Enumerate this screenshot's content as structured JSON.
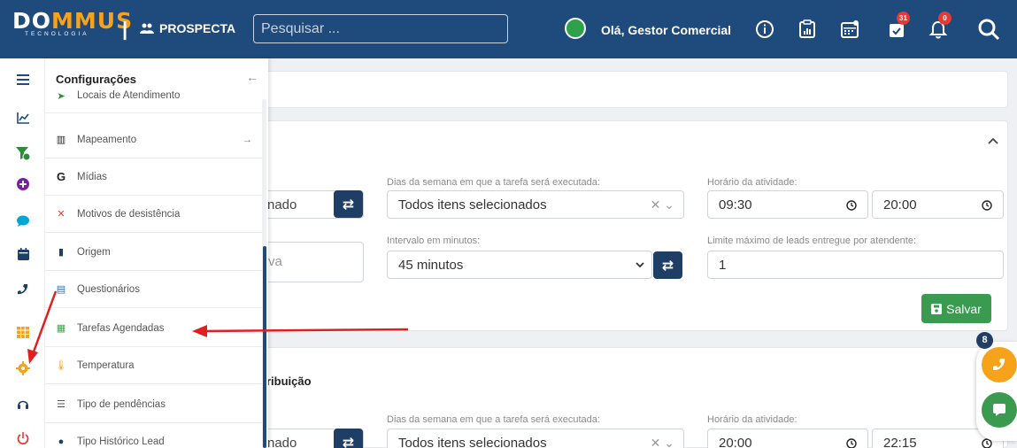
{
  "header": {
    "logo_brand_pre": "DO",
    "logo_brand_u": "MMUS",
    "logo_sub": "TECNOLOGIA",
    "separator": "|",
    "module": "PROSPECTA",
    "search_placeholder": "Pesquisar ...",
    "greeting": "Olá, Gestor Comercial",
    "calendar_badge": "31",
    "notifications_badge": "0"
  },
  "panel": {
    "title": "Configurações",
    "items": [
      {
        "label": "Locais de Atendimento",
        "icon": "location-arrow-icon"
      },
      {
        "label": "Mapeamento",
        "icon": "map-icon"
      },
      {
        "label": "Mídias",
        "icon": "google-icon"
      },
      {
        "label": "Motivos de desistência",
        "icon": "close-icon"
      },
      {
        "label": "Origem",
        "icon": "bookmark-icon"
      },
      {
        "label": "Questionários",
        "icon": "file-icon"
      },
      {
        "label": "Tarefas Agendadas",
        "icon": "calendar-icon"
      },
      {
        "label": "Temperatura",
        "icon": "thermometer-icon"
      },
      {
        "label": "Tipo de pendências",
        "icon": "list-icon"
      },
      {
        "label": "Tipo Histórico Lead",
        "icon": "circle-icon"
      }
    ]
  },
  "main": {
    "section2_title_partial": "ribuição",
    "row1": {
      "left_partial": "nado",
      "days_label": "Dias da semana em que a tarefa será executada:",
      "days_value": "Todos itens selecionados",
      "time_label": "Horário da atividade:",
      "time_start": "09:30",
      "time_end": "20:00"
    },
    "row2": {
      "left_partial": "va",
      "interval_label": "Intervalo em minutos:",
      "interval_value": "45 minutos",
      "limit_label": "Limite máximo de leads entregue por atendente:",
      "limit_value": "1"
    },
    "save_label": "Salvar",
    "row3": {
      "left_partial": "nado",
      "days_label": "Dias da semana em que a tarefa será executada:",
      "days_value": "Todos itens selecionados",
      "time_label": "Horário da atividade:",
      "time_start": "20:00",
      "time_end": "22:15"
    }
  },
  "floating": {
    "badge": "8"
  },
  "colors": {
    "navbar": "#1f4a7c",
    "accent_orange": "#f7a21b",
    "save_green": "#3a9a4f",
    "annotation_red": "#e02020"
  }
}
